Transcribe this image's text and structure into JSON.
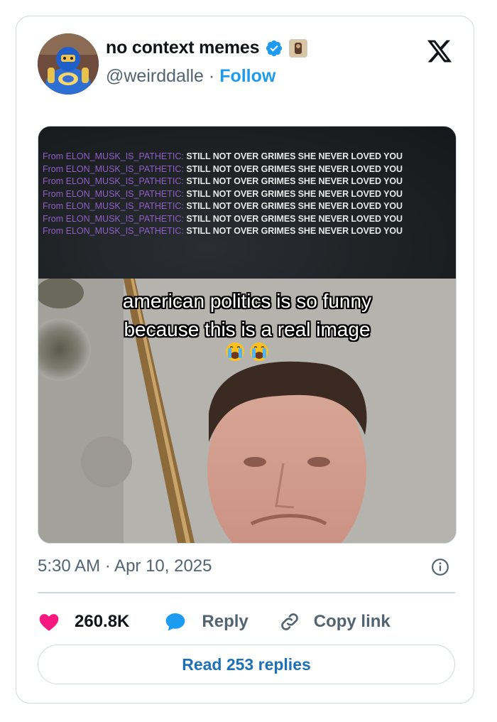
{
  "author": {
    "display_name": "no context memes",
    "handle": "@weirddalle",
    "separator": "·",
    "follow_label": "Follow"
  },
  "media": {
    "chat_lines": [
      {
        "from": "From ELON_MUSK_IS_PATHETIC:",
        "message": "STILL NOT OVER GRIMES SHE NEVER LOVED YOU"
      },
      {
        "from": "From ELON_MUSK_IS_PATHETIC:",
        "message": "STILL NOT OVER GRIMES SHE NEVER LOVED YOU"
      },
      {
        "from": "From ELON_MUSK_IS_PATHETIC:",
        "message": "STILL NOT OVER GRIMES SHE NEVER LOVED YOU"
      },
      {
        "from": "From ELON_MUSK_IS_PATHETIC:",
        "message": "STILL NOT OVER GRIMES SHE NEVER LOVED YOU"
      },
      {
        "from": "From ELON_MUSK_IS_PATHETIC:",
        "message": "STILL NOT OVER GRIMES SHE NEVER LOVED YOU"
      },
      {
        "from": "From ELON_MUSK_IS_PATHETIC:",
        "message": "STILL NOT OVER GRIMES SHE NEVER LOVED YOU"
      },
      {
        "from": "From ELON_MUSK_IS_PATHETIC:",
        "message": "STILL NOT OVER GRIMES SHE NEVER LOVED YOU"
      }
    ],
    "caption_line1": "american politics is so funny",
    "caption_line2": "because this is a real image"
  },
  "timestamp": "5:30 AM · Apr 10, 2025",
  "actions": {
    "likes_count": "260.8K",
    "reply_label": "Reply",
    "copy_label": "Copy link"
  },
  "read_replies_label": "Read 253 replies",
  "colors": {
    "accent": "#1d9bf0",
    "like": "#f91880",
    "muted": "#536471",
    "border": "#cfd9de"
  },
  "icons": [
    "x-logo-icon",
    "verified-badge-icon",
    "info-icon",
    "heart-icon",
    "reply-bubble-icon",
    "link-icon",
    "crying-emoji-icon"
  ]
}
